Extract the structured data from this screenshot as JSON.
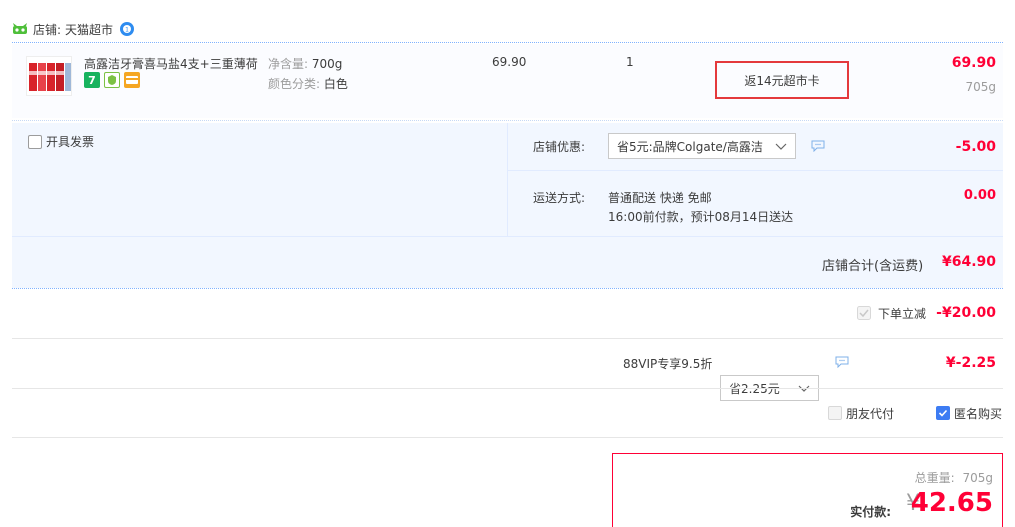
{
  "shop": {
    "label": "店铺:",
    "name": "天猫超市"
  },
  "item": {
    "title": "高露洁牙膏喜马盐4支+三重薄荷",
    "sku_label_1": "净含量:",
    "sku_value_1": "700g",
    "sku_label_2": "颜色分类:",
    "sku_value_2": "白色",
    "unit_price": "69.90",
    "quantity": "1",
    "rebate": "返14元超市卡",
    "subtotal": "69.90",
    "weight": "705g"
  },
  "order_extra": {
    "invoice_label": "开具发票",
    "discount_label": "店铺优惠:",
    "discount_selected": "省5元:品牌Colgate/高露洁",
    "discount_amount": "-5.00",
    "shipping_label": "运送方式:",
    "shipping_line1": "普通配送 快递 免邮",
    "shipping_line2": "16:00前付款，预计08月14日送达",
    "shipping_amount": "0.00",
    "shop_total_label": "店铺合计(含运费)",
    "shop_total_value": "¥64.90"
  },
  "instant_discount": {
    "label": "下单立减",
    "amount": "-¥20.00"
  },
  "vip": {
    "label": "88VIP专享9.5折",
    "selected": "省2.25元",
    "amount": "¥-2.25"
  },
  "options": {
    "friend_pay": "朋友代付",
    "anonymous": "匿名购买"
  },
  "summary": {
    "total_weight_label": "总重量:",
    "total_weight": "705g",
    "pay_label": "实付款:",
    "currency": "¥",
    "pay_amount": "42.65"
  },
  "colors": {
    "accent_red": "#ff0036",
    "highlight_border": "#e4393c",
    "checkbox_blue": "#3d7cf3",
    "block_bg": "#f2f7ff"
  }
}
